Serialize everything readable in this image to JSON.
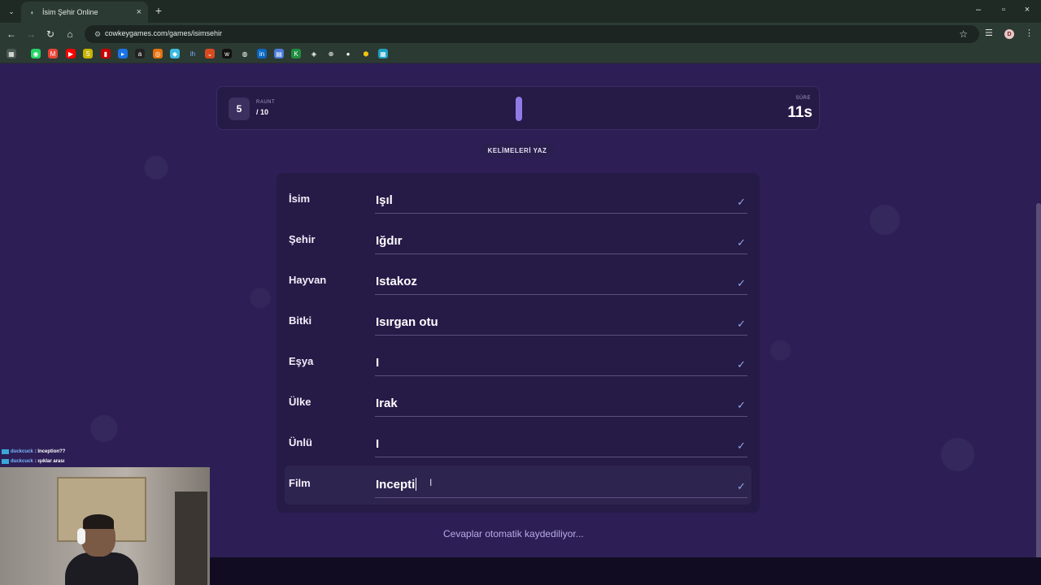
{
  "browser": {
    "tab_title": "İsim Şehir Online",
    "url": "cowkeygames.com/games/isimsehir",
    "profile_initial": "D"
  },
  "game": {
    "round_label": "RAUNT",
    "round_current": "5",
    "round_total": "/ 10",
    "time_label": "SÜRE",
    "time_value": "11s",
    "progress_fraction": 0.0,
    "section_title": "KELİMELERİ YAZ",
    "autosave_text": "Cevaplar otomatik kaydediliyor...",
    "rows": [
      {
        "label": "İsim",
        "value": "Işıl"
      },
      {
        "label": "Şehir",
        "value": "Iğdır"
      },
      {
        "label": "Hayvan",
        "value": "Istakoz"
      },
      {
        "label": "Bitki",
        "value": "Isırgan otu"
      },
      {
        "label": "Eşya",
        "value": "I"
      },
      {
        "label": "Ülke",
        "value": "Irak"
      },
      {
        "label": "Ünlü",
        "value": "I"
      },
      {
        "label": "Film",
        "value": "Incepti"
      }
    ]
  },
  "chat": [
    {
      "user": "duckcuck",
      "message": ": Inception??"
    },
    {
      "user": "duckcuck",
      "message": ": ışıklar arası"
    }
  ],
  "colors": {
    "page_bg": "#2d1f55",
    "card_bg": "#261a47",
    "accent": "#8f7ae6",
    "check": "#8ea8e8"
  }
}
